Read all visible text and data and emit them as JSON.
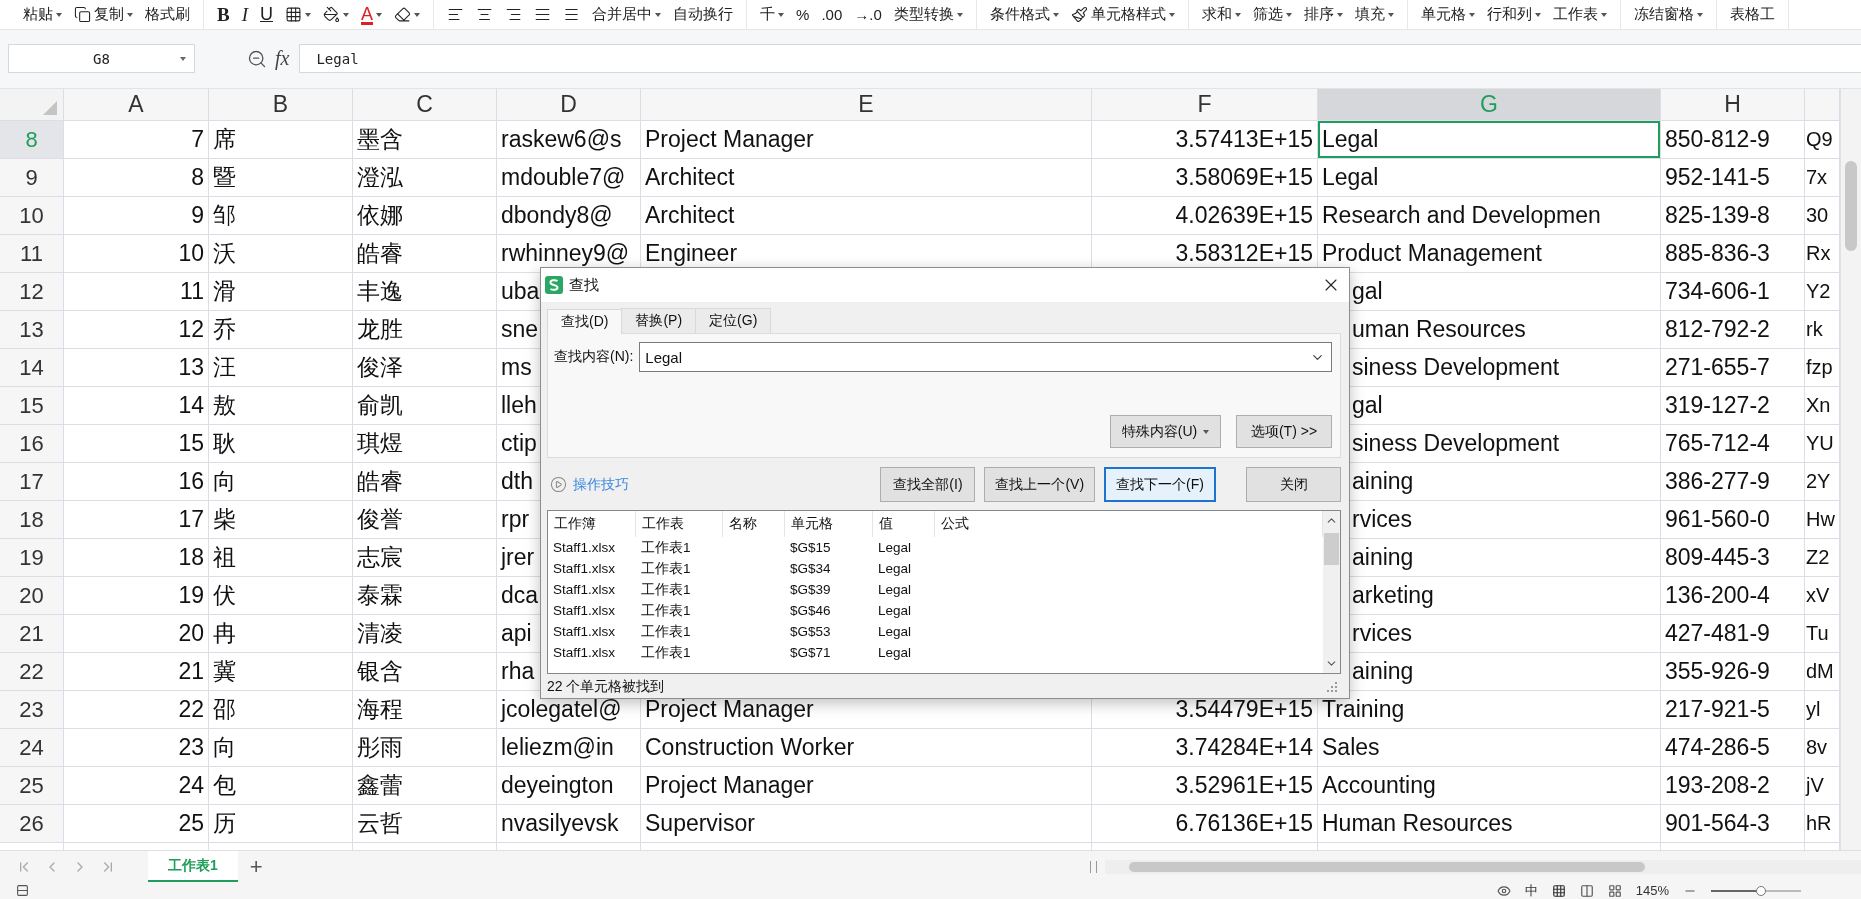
{
  "ribbon": {
    "groups": [
      [
        {
          "kind": "text",
          "label": "粘贴",
          "caret": true
        },
        {
          "kind": "copy",
          "label": "复制",
          "caret": true
        },
        {
          "kind": "text",
          "label": "格式刷"
        }
      ],
      [
        {
          "kind": "bold",
          "label": "B"
        },
        {
          "kind": "italic",
          "label": "I"
        },
        {
          "kind": "underline",
          "label": "U"
        },
        {
          "kind": "border",
          "caret": true
        },
        {
          "kind": "fill",
          "caret": true
        },
        {
          "kind": "fontcolor",
          "label": "A",
          "caret": true
        },
        {
          "kind": "eraser",
          "caret": true
        }
      ],
      [
        {
          "kind": "align-left"
        },
        {
          "kind": "align-center"
        },
        {
          "kind": "align-right"
        },
        {
          "kind": "align-justify"
        },
        {
          "kind": "align-distributed"
        },
        {
          "kind": "text",
          "label": "合并居中",
          "caret": true
        },
        {
          "kind": "text",
          "label": "自动换行"
        }
      ],
      [
        {
          "kind": "text",
          "label": "千",
          "caret": true
        },
        {
          "kind": "text",
          "label": "%"
        },
        {
          "kind": "text",
          "label": ".00"
        },
        {
          "kind": "text",
          "label": "→.0"
        },
        {
          "kind": "text",
          "label": "类型转换",
          "caret": true
        }
      ],
      [
        {
          "kind": "text",
          "label": "条件格式",
          "caret": true
        },
        {
          "kind": "brush",
          "label": "单元格样式",
          "caret": true
        }
      ],
      [
        {
          "kind": "text",
          "label": "求和",
          "caret": true
        },
        {
          "kind": "text",
          "label": "筛选",
          "caret": true
        },
        {
          "kind": "text",
          "label": "排序",
          "caret": true
        },
        {
          "kind": "text",
          "label": "填充",
          "caret": true
        }
      ],
      [
        {
          "kind": "text",
          "label": "单元格",
          "caret": true
        },
        {
          "kind": "text",
          "label": "行和列",
          "caret": true
        },
        {
          "kind": "text",
          "label": "工作表",
          "caret": true
        }
      ],
      [
        {
          "kind": "text",
          "label": "冻结窗格",
          "caret": true
        }
      ],
      [
        {
          "kind": "text",
          "label": "表格工"
        }
      ]
    ]
  },
  "formula_bar": {
    "name_box": "G8",
    "function_label": "fx",
    "formula": "Legal"
  },
  "columns": [
    {
      "label": "A",
      "selected": false
    },
    {
      "label": "B",
      "selected": false
    },
    {
      "label": "C",
      "selected": false
    },
    {
      "label": "D",
      "selected": false
    },
    {
      "label": "E",
      "selected": false
    },
    {
      "label": "F",
      "selected": false
    },
    {
      "label": "G",
      "selected": true
    },
    {
      "label": "H",
      "selected": false
    }
  ],
  "rows": [
    {
      "number": "8",
      "selected": true,
      "a": "7",
      "b": "席",
      "c": "墨含",
      "d": "raskew6@s",
      "e": "Project Manager",
      "f": "3.57413E+15",
      "g": "Legal",
      "h": "850-812-9",
      "i": "Q9"
    },
    {
      "number": "9",
      "selected": false,
      "a": "8",
      "b": "暨",
      "c": "澄泓",
      "d": "mdouble7@",
      "e": "Architect",
      "f": "3.58069E+15",
      "g": "Legal",
      "h": "952-141-5",
      "i": "7x"
    },
    {
      "number": "10",
      "selected": false,
      "a": "9",
      "b": "邹",
      "c": "依娜",
      "d": "dbondy8@",
      "e": "Architect",
      "f": "4.02639E+15",
      "g": "Research and Developmen",
      "h": "825-139-8",
      "i": "30"
    },
    {
      "number": "11",
      "selected": false,
      "a": "10",
      "b": "沃",
      "c": "皓睿",
      "d": "rwhinney9@",
      "e": "Engineer",
      "f": "3.58312E+15",
      "g": "Product Management",
      "h": "885-836-3",
      "i": "Rx"
    },
    {
      "number": "12",
      "selected": false,
      "a": "11",
      "b": "滑",
      "c": "丰逸",
      "d": "uba",
      "g": "gal",
      "h": "734-606-1",
      "i": "Y2"
    },
    {
      "number": "13",
      "selected": false,
      "a": "12",
      "b": "乔",
      "c": "龙胜",
      "d": "sne",
      "g": "uman Resources",
      "h": "812-792-2",
      "i": "rk"
    },
    {
      "number": "14",
      "selected": false,
      "a": "13",
      "b": "汪",
      "c": "俊泽",
      "d": "ms",
      "g": "siness Development",
      "h": "271-655-7",
      "i": "fzp"
    },
    {
      "number": "15",
      "selected": false,
      "a": "14",
      "b": "敖",
      "c": "俞凯",
      "d": "lleh",
      "g": "gal",
      "h": "319-127-2",
      "i": "Xn"
    },
    {
      "number": "16",
      "selected": false,
      "a": "15",
      "b": "耿",
      "c": "琪煜",
      "d": "ctip",
      "g": "siness Development",
      "h": "765-712-4",
      "i": "YU"
    },
    {
      "number": "17",
      "selected": false,
      "a": "16",
      "b": "向",
      "c": "皓睿",
      "d": "dth",
      "g": "aining",
      "h": "386-277-9",
      "i": "2Y"
    },
    {
      "number": "18",
      "selected": false,
      "a": "17",
      "b": "柴",
      "c": "俊誉",
      "d": "rpr",
      "g": "rvices",
      "h": "961-560-0",
      "i": "Hw"
    },
    {
      "number": "19",
      "selected": false,
      "a": "18",
      "b": "祖",
      "c": "志宸",
      "d": "jrer",
      "g": "aining",
      "h": "809-445-3",
      "i": "Z2"
    },
    {
      "number": "20",
      "selected": false,
      "a": "19",
      "b": "伏",
      "c": "泰霖",
      "d": "dca",
      "g": "arketing",
      "h": "136-200-4",
      "i": "xV"
    },
    {
      "number": "21",
      "selected": false,
      "a": "20",
      "b": "冉",
      "c": "清凌",
      "d": "api",
      "g": "rvices",
      "h": "427-481-9",
      "i": "Tu"
    },
    {
      "number": "22",
      "selected": false,
      "a": "21",
      "b": "冀",
      "c": "银含",
      "d": "rha",
      "g": "aining",
      "h": "355-926-9",
      "i": "dM"
    },
    {
      "number": "23",
      "selected": false,
      "a": "22",
      "b": "邵",
      "c": "海程",
      "d": "jcolegatel@",
      "e": "Project Manager",
      "f": "3.54479E+15",
      "g": "Training",
      "h": "217-921-5",
      "i": "yl"
    },
    {
      "number": "24",
      "selected": false,
      "a": "23",
      "b": "向",
      "c": "彤雨",
      "d": "leliezm@in",
      "e": "Construction Worker",
      "f": "3.74284E+14",
      "g": "Sales",
      "h": "474-286-5",
      "i": "8v"
    },
    {
      "number": "25",
      "selected": false,
      "a": "24",
      "b": "包",
      "c": "鑫蕾",
      "d": "deyeington",
      "e": "Project Manager",
      "f": "3.52961E+15",
      "g": "Accounting",
      "h": "193-208-2",
      "i": "jV"
    },
    {
      "number": "26",
      "selected": false,
      "a": "25",
      "b": "历",
      "c": "云哲",
      "d": "nvasilyevsk",
      "e": "Supervisor",
      "f": "6.76136E+15",
      "g": "Human Resources",
      "h": "901-564-3",
      "i": "hR"
    }
  ],
  "dialog": {
    "title": "查找",
    "tabs": [
      {
        "label": "查找(D)",
        "selected": true
      },
      {
        "label": "替换(P)",
        "selected": false
      },
      {
        "label": "定位(G)",
        "selected": false
      }
    ],
    "find_label": "查找内容(N):",
    "find_value": "Legal",
    "special_button": "特殊内容(U)",
    "options_button": "选项(T) >>",
    "tips_link": "操作技巧",
    "buttons": [
      {
        "label": "查找全部(I)",
        "default": false
      },
      {
        "label": "查找上一个(V)",
        "default": false
      },
      {
        "label": "查找下一个(F)",
        "default": true
      },
      {
        "label": "关闭",
        "default": false
      }
    ],
    "results": {
      "columns": [
        "工作簿",
        "工作表",
        "名称",
        "单元格",
        "值",
        "公式"
      ],
      "rows": [
        {
          "workbook": "Staff1.xlsx",
          "sheet": "工作表1",
          "cell": "$G$15",
          "value": "Legal"
        },
        {
          "workbook": "Staff1.xlsx",
          "sheet": "工作表1",
          "cell": "$G$34",
          "value": "Legal"
        },
        {
          "workbook": "Staff1.xlsx",
          "sheet": "工作表1",
          "cell": "$G$39",
          "value": "Legal"
        },
        {
          "workbook": "Staff1.xlsx",
          "sheet": "工作表1",
          "cell": "$G$46",
          "value": "Legal"
        },
        {
          "workbook": "Staff1.xlsx",
          "sheet": "工作表1",
          "cell": "$G$53",
          "value": "Legal"
        },
        {
          "workbook": "Staff1.xlsx",
          "sheet": "工作表1",
          "cell": "$G$71",
          "value": "Legal"
        }
      ]
    },
    "status": "22 个单元格被找到"
  },
  "sheet_tabs": [
    {
      "label": "工作表1",
      "selected": true
    }
  ],
  "add_sheet": "+",
  "status_bar": {
    "input_mode": "中",
    "zoom": "145%",
    "zoom_slider": {
      "level": 0.55
    }
  }
}
